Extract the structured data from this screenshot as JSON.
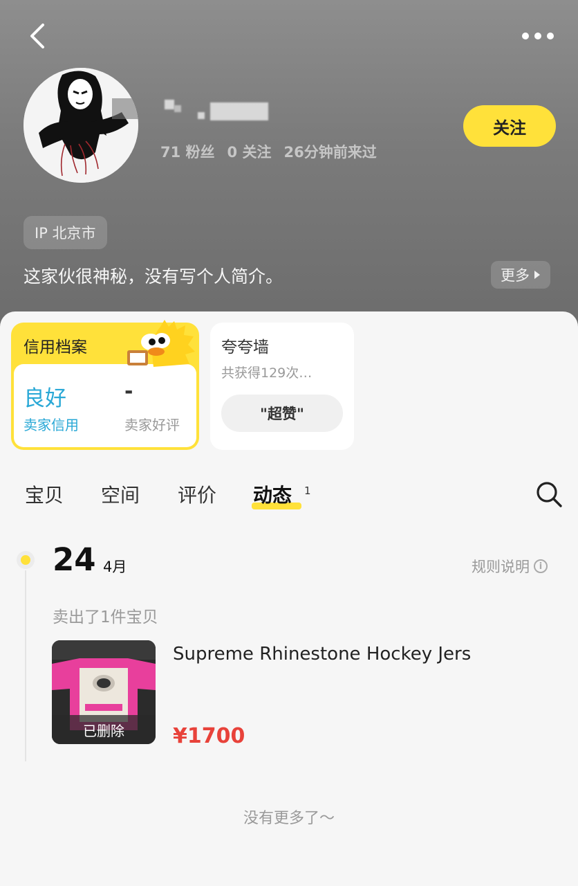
{
  "header": {
    "back_icon": "chevron-left-icon",
    "more_icon": "more-dots-icon"
  },
  "profile": {
    "stats": [
      {
        "value": "71",
        "label": "粉丝"
      },
      {
        "value": "0",
        "label": "关注"
      }
    ],
    "last_seen": "26分钟前来过",
    "follow_label": "关注",
    "ip_label": "IP 北京市",
    "bio": "这家伙很神秘，没有写个人简介。",
    "bio_more_label": "更多"
  },
  "credit": {
    "title": "信用档案",
    "rating": "良好",
    "rating_label": "卖家信用",
    "good_review_value": "-",
    "good_review_label": "卖家好评"
  },
  "praise_wall": {
    "title": "夸夸墙",
    "subtitle": "共获得129次…",
    "tag": "\"超赞\""
  },
  "tabs": [
    {
      "label": "宝贝"
    },
    {
      "label": "空间"
    },
    {
      "label": "评价"
    },
    {
      "label": "动态",
      "badge": "1",
      "active": true
    }
  ],
  "feed": {
    "day": "24",
    "month": "4月",
    "rules_label": "规则说明",
    "event_text": "卖出了1件宝贝",
    "item": {
      "title": "Supreme Rhinestone Hockey Jers",
      "status": "已删除",
      "price": "¥1700"
    },
    "end_text": "没有更多了～"
  },
  "colors": {
    "accent_yellow": "#ffe13a",
    "credit_blue": "#29a8d6",
    "price_red": "#e8423a"
  }
}
